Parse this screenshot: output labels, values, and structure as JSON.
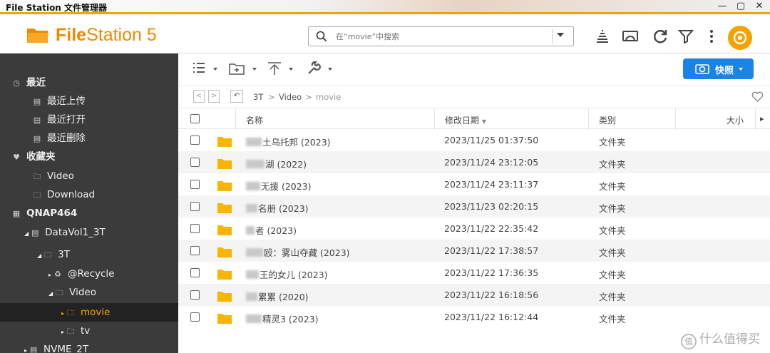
{
  "window": {
    "title": "File Station 文件管理器"
  },
  "app": {
    "name_bold": "File",
    "name_rest": "Station 5"
  },
  "search": {
    "placeholder": "在“movie”中搜索"
  },
  "sidebar": {
    "items": [
      {
        "label": "最近",
        "icon": "clock-icon",
        "level": 0
      },
      {
        "label": "最近上传",
        "icon": "list-icon",
        "level": 1
      },
      {
        "label": "最近打开",
        "icon": "list-icon",
        "level": 1
      },
      {
        "label": "最近删除",
        "icon": "list-icon",
        "level": 1
      },
      {
        "label": "收藏夹",
        "icon": "heart-icon",
        "level": 0
      },
      {
        "label": "Video",
        "icon": "folder-icon",
        "level": 1
      },
      {
        "label": "Download",
        "icon": "folder-icon",
        "level": 1
      },
      {
        "label": "QNAP464",
        "icon": "server-icon",
        "level": 0
      },
      {
        "label": "DataVol1_3T",
        "icon": "drive-icon",
        "level": 1
      },
      {
        "label": "3T",
        "icon": "folder-icon",
        "level": 2
      },
      {
        "label": "@Recycle",
        "icon": "recycle-icon",
        "level": 3
      },
      {
        "label": "Video",
        "icon": "folder-icon",
        "level": 3
      },
      {
        "label": "movie",
        "icon": "folder-icon",
        "level": 4
      },
      {
        "label": "tv",
        "icon": "folder-icon",
        "level": 4
      },
      {
        "label": "NVME_2T",
        "icon": "drive-icon",
        "level": 1
      }
    ]
  },
  "toolbar": {
    "snapshot_label": "快照"
  },
  "breadcrumb": [
    "3T",
    "Video",
    "movie"
  ],
  "columns": {
    "name": "名称",
    "modified": "修改日期",
    "type": "类别",
    "size": "大小"
  },
  "files": [
    {
      "name_visible": "土乌托邦 (2023)",
      "date": "2023/11/25 01:37:50",
      "type": "文件夹"
    },
    {
      "name_visible": "湖 (2022)",
      "date": "2023/11/24 23:12:05",
      "type": "文件夹"
    },
    {
      "name_visible": "无援 (2023)",
      "date": "2023/11/24 23:11:37",
      "type": "文件夹"
    },
    {
      "name_visible": "名册 (2023)",
      "date": "2023/11/23 02:20:15",
      "type": "文件夹"
    },
    {
      "name_visible": "者 (2023)",
      "date": "2023/11/22 22:35:42",
      "type": "文件夹"
    },
    {
      "name_visible": "殴：雾山夺藏 (2023)",
      "date": "2023/11/22 17:38:57",
      "type": "文件夹"
    },
    {
      "name_visible": "王的女儿 (2023)",
      "date": "2023/11/22 17:36:35",
      "type": "文件夹"
    },
    {
      "name_visible": "累累 (2020)",
      "date": "2023/11/22 16:18:56",
      "type": "文件夹"
    },
    {
      "name_visible": "精灵3 (2023)",
      "date": "2023/11/22 16:12:44",
      "type": "文件夹"
    }
  ],
  "watermark": "什么值得买",
  "colors": {
    "accent": "#f5a200",
    "sidebar_bg": "#3b3b3b",
    "snapshot_btn": "#1b82e6",
    "folder": "#f7b500"
  }
}
